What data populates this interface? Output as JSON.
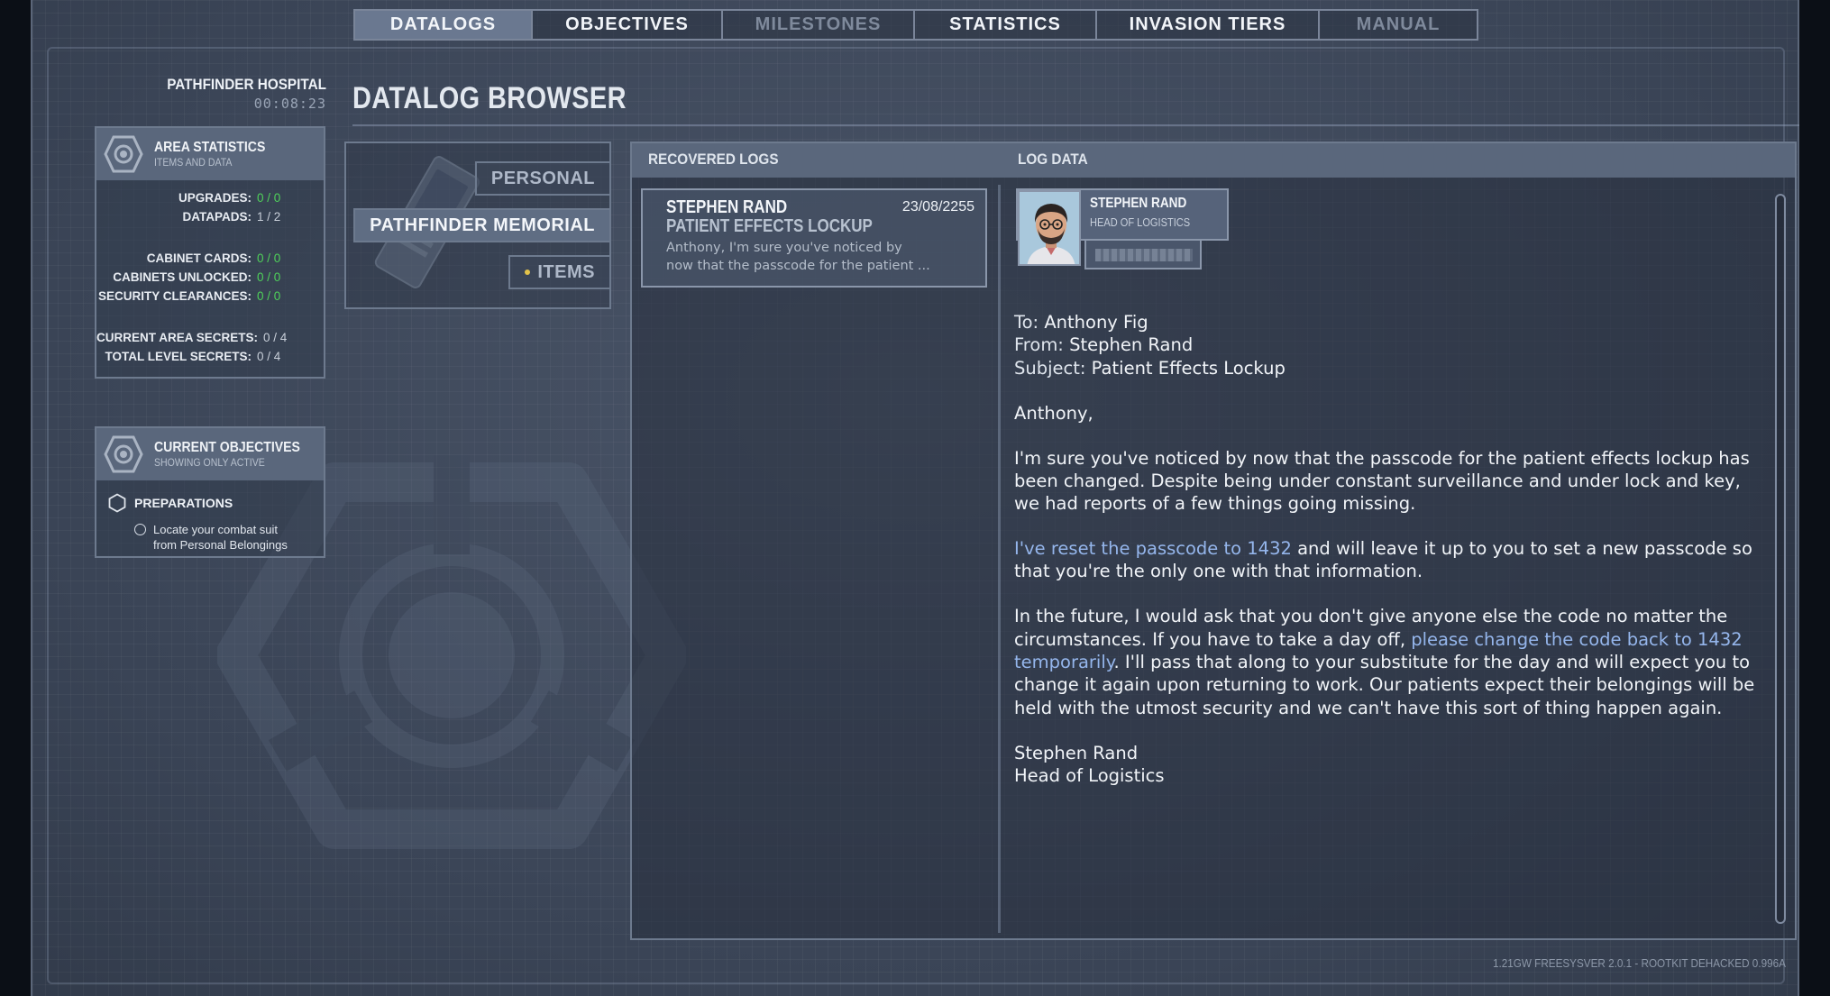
{
  "tabs": [
    {
      "label": "DATALOGS"
    },
    {
      "label": "OBJECTIVES"
    },
    {
      "label": "MILESTONES"
    },
    {
      "label": "STATISTICS"
    },
    {
      "label": "INVASION TIERS"
    },
    {
      "label": "MANUAL"
    }
  ],
  "location": {
    "name": "PATHFINDER HOSPITAL",
    "time": "00:08:23"
  },
  "page_title": "DATALOG BROWSER",
  "area_statistics": {
    "title": "AREA STATISTICS",
    "subtitle": "ITEMS AND DATA",
    "rows": [
      {
        "label": "UPGRADES:",
        "value": "0 / 0"
      },
      {
        "label": "DATAPADS:",
        "value": "1 / 2"
      },
      {
        "label": "CABINET CARDS:",
        "value": "0 / 0"
      },
      {
        "label": "CABINETS UNLOCKED:",
        "value": "0 / 0"
      },
      {
        "label": "SECURITY CLEARANCES:",
        "value": "0 / 0"
      },
      {
        "label": "CURRENT AREA SECRETS:",
        "value": "0 / 4"
      },
      {
        "label": "TOTAL LEVEL SECRETS:",
        "value": "0 / 4"
      }
    ]
  },
  "current_objectives": {
    "title": "CURRENT OBJECTIVES",
    "subtitle": "SHOWING ONLY ACTIVE",
    "group_title": "PREPARATIONS",
    "items": [
      "Locate your combat suit",
      "from Personal Belongings"
    ]
  },
  "categories": {
    "personal": "PERSONAL",
    "memorial": "PATHFINDER MEMORIAL",
    "items": "ITEMS"
  },
  "recovered_logs": {
    "heading": "RECOVERED LOGS",
    "entry": {
      "author": "STEPHEN RAND",
      "date": "23/08/2255",
      "subject": "PATIENT EFFECTS LOCKUP",
      "preview_line1": "Anthony,  I'm sure you've noticed by",
      "preview_line2": "now that the passcode for the patient ..."
    }
  },
  "log_data": {
    "heading": "LOG DATA",
    "author_name": "STEPHEN RAND",
    "author_role": "HEAD OF LOGISTICS",
    "to_label": "To:",
    "to": "Anthony Fig",
    "from_label": "From:",
    "from": "Stephen Rand",
    "subject_label": "Subject:",
    "subject": "Patient Effects Lockup",
    "greeting": "Anthony,",
    "p1": "I'm sure you've noticed by now that the passcode for the patient effects lockup has been changed. Despite being under constant surveillance and under lock and key, we had reports of a few things going missing.",
    "p2_highlight": "I've reset the passcode to 1432",
    "p2_rest": " and will leave it up to you to set a new passcode so that you're the only one with that information.",
    "p3_start": "In the future, I would ask that you don't give anyone else the code no matter the circumstances. If you have to take a day off, ",
    "p3_highlight": "please change the code back to 1432 temporarily",
    "p3_rest": ". I'll pass that along to your substitute for the day and will expect you to change it again upon returning to work. Our patients expect their belongings will be held with the utmost security and we can't have this sort of thing happen again.",
    "sign_name": "Stephen Rand",
    "sign_role": "Head of Logistics"
  },
  "footer": {
    "free": "1.21GW FREE",
    "sysver": "SYSVER 2.0.1 - ROOTKIT DEHACKED  0.996A"
  },
  "colors": {
    "accent_green": "#4fd15a",
    "highlight_blue": "#95b6ec",
    "active_tab": "#6a7890",
    "item_dot": "#e2c24a"
  }
}
